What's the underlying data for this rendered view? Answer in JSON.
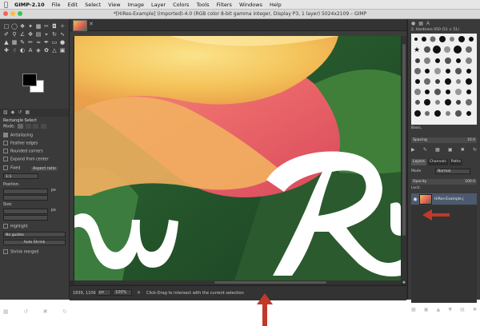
{
  "menubar": {
    "app": "GIMP-2.10",
    "items": [
      "File",
      "Edit",
      "Select",
      "View",
      "Image",
      "Layer",
      "Colors",
      "Tools",
      "Filters",
      "Windows",
      "Help"
    ]
  },
  "window": {
    "title": "*[HiRes-Example] (imported)-4.0 (RGB color 8-bit gamma integer, Display P3, 1 layer) 5024x2109 – GIMP"
  },
  "toolbox": {
    "options_title": "Rectangle Select",
    "mode_label": "Mode:",
    "antialiasing": "Antialiasing",
    "feather_edges": "Feather edges",
    "rounded_corners": "Rounded corners",
    "expand_from_center": "Expand from center",
    "fixed_label": "Fixed",
    "fixed_value": "Aspect ratio",
    "ratio_value": "1:1",
    "position_label": "Position:",
    "position_unit": "px",
    "size_label": "Size:",
    "size_unit": "px",
    "highlight": "Highlight",
    "guides_value": "No guides",
    "auto_shrink": "Auto Shrink",
    "shrink_merged": "Shrink merged"
  },
  "status": {
    "coords": "1839, 1106",
    "unit": "px",
    "zoom": "100%",
    "message": "Click-Drag to intersect with the current selection"
  },
  "dock": {
    "brush_header": "2. Hardness 050 (51 × 51)",
    "brush_label": "Basic,",
    "spacing_label": "Spacing",
    "spacing_value": "10.0",
    "tabs": [
      "Layers",
      "Channels",
      "Paths"
    ],
    "mode_label": "Mode",
    "mode_value": "Normal",
    "opacity_label": "Opacity",
    "opacity_value": "100.0",
    "lock_label": "Lock:",
    "layer_name": "HiRes-Example.j"
  },
  "canvas": {
    "script_text": "w R"
  },
  "colors": {
    "arrow": "#c0392b"
  }
}
